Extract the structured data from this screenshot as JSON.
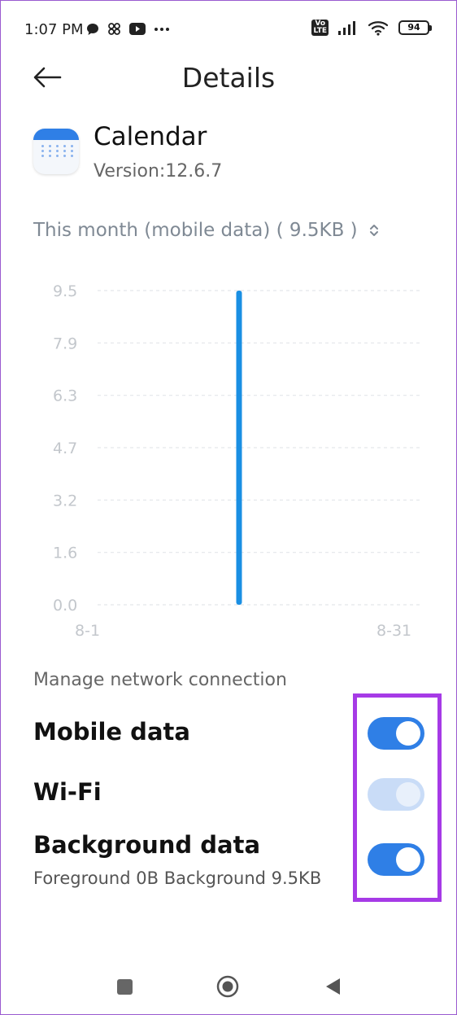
{
  "status": {
    "time": "1:07 PM",
    "battery": "94",
    "volte": "Vo\nLTE"
  },
  "header": {
    "title": "Details"
  },
  "app": {
    "name": "Calendar",
    "version": "Version:12.6.7"
  },
  "period": {
    "label": "This month (mobile data) ( 9.5KB )"
  },
  "chart_data": {
    "type": "bar",
    "ylim": [
      0,
      9.5
    ],
    "yticks": [
      "9.5",
      "7.9",
      "6.3",
      "4.7",
      "3.2",
      "1.6",
      "0.0"
    ],
    "x_start_label": "8-1",
    "x_end_label": "8-31",
    "points": [
      {
        "x": "8-16",
        "y": 9.5
      }
    ]
  },
  "network": {
    "section_label": "Manage network connection",
    "mobile_data": {
      "label": "Mobile data",
      "on": true
    },
    "wifi": {
      "label": "Wi-Fi",
      "on": true,
      "disabled": true
    },
    "background_data": {
      "label": "Background data",
      "on": true
    },
    "usage_detail": "Foreground 0B  Background 9.5KB"
  },
  "colors": {
    "accent": "#2f7fe6",
    "highlight": "#a63ae6",
    "bar": "#1a8fe3"
  }
}
